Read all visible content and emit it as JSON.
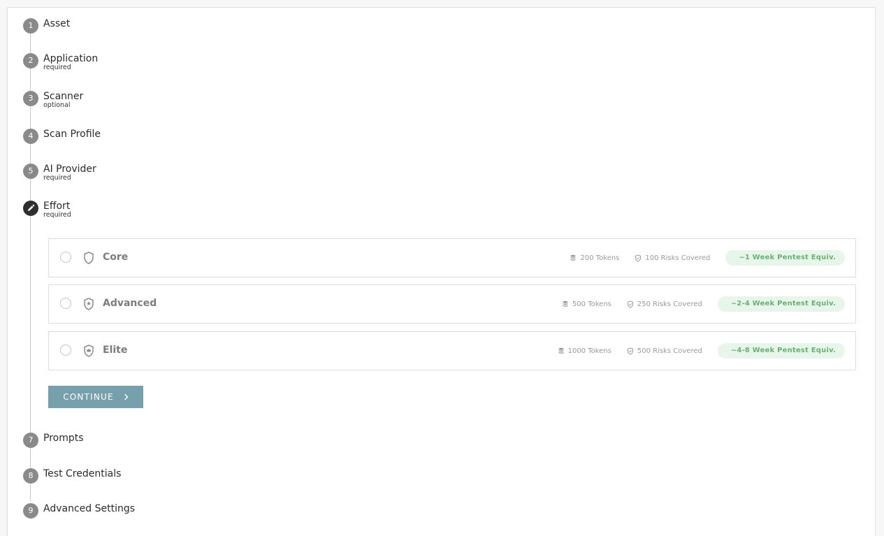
{
  "steps": [
    {
      "num": "1",
      "label": "Asset",
      "sub": ""
    },
    {
      "num": "2",
      "label": "Application",
      "sub": "required"
    },
    {
      "num": "3",
      "label": "Scanner",
      "sub": "optional"
    },
    {
      "num": "4",
      "label": "Scan Profile",
      "sub": ""
    },
    {
      "num": "5",
      "label": "AI Provider",
      "sub": "required"
    },
    {
      "num": "",
      "label": "Effort",
      "sub": "required",
      "icon": "pencil-icon"
    },
    {
      "num": "7",
      "label": "Prompts",
      "sub": ""
    },
    {
      "num": "8",
      "label": "Test Credentials",
      "sub": ""
    },
    {
      "num": "9",
      "label": "Advanced Settings",
      "sub": ""
    }
  ],
  "effort_options": [
    {
      "name": "Core",
      "tokens": "200 Tokens",
      "risks": "100 Risks Covered",
      "badge": "~1 Week Pentest Equiv.",
      "icon": "shield-icon"
    },
    {
      "name": "Advanced",
      "tokens": "500 Tokens",
      "risks": "250 Risks Covered",
      "badge": "~2-4 Week Pentest Equiv.",
      "icon": "shield-star-icon"
    },
    {
      "name": "Elite",
      "tokens": "1000 Tokens",
      "risks": "500 Risks Covered",
      "badge": "~4-8 Week Pentest Equiv.",
      "icon": "shield-crown-icon"
    }
  ],
  "continue_label": "CONTINUE",
  "colors": {
    "active_step": "#2e2e2e",
    "inactive_step": "#8a8a8a",
    "button": "#77a0ad",
    "badge_bg": "#e8f5ea",
    "badge_text": "#67b36f"
  }
}
